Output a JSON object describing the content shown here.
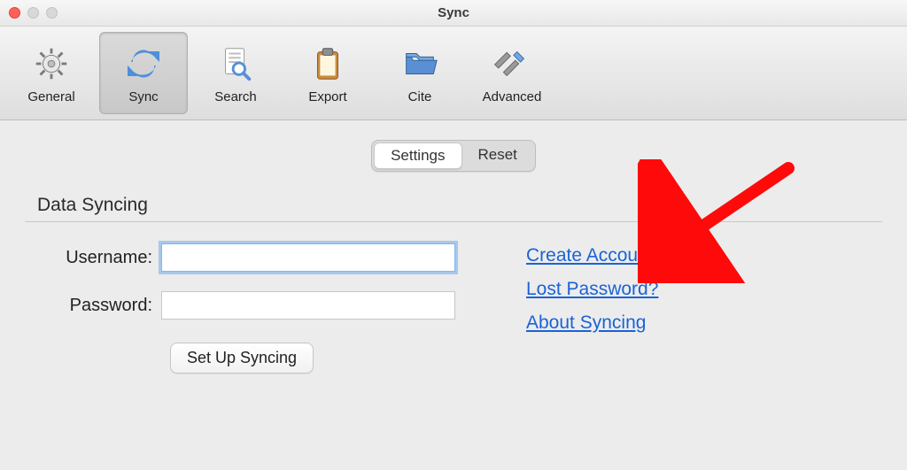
{
  "window": {
    "title": "Sync"
  },
  "toolbar": {
    "items": [
      {
        "label": "General"
      },
      {
        "label": "Sync"
      },
      {
        "label": "Search"
      },
      {
        "label": "Export"
      },
      {
        "label": "Cite"
      },
      {
        "label": "Advanced"
      }
    ],
    "selected_index": 1
  },
  "subtabs": {
    "settings": "Settings",
    "reset": "Reset",
    "active": "settings"
  },
  "section": {
    "title": "Data Syncing"
  },
  "form": {
    "username_label": "Username:",
    "username_value": "",
    "password_label": "Password:",
    "password_value": "",
    "setup_button": "Set Up Syncing"
  },
  "links": {
    "create_account": "Create Account",
    "lost_password": "Lost Password?",
    "about_syncing": "About Syncing"
  },
  "colors": {
    "link": "#1a63d6",
    "arrow": "#ff0a0a"
  }
}
